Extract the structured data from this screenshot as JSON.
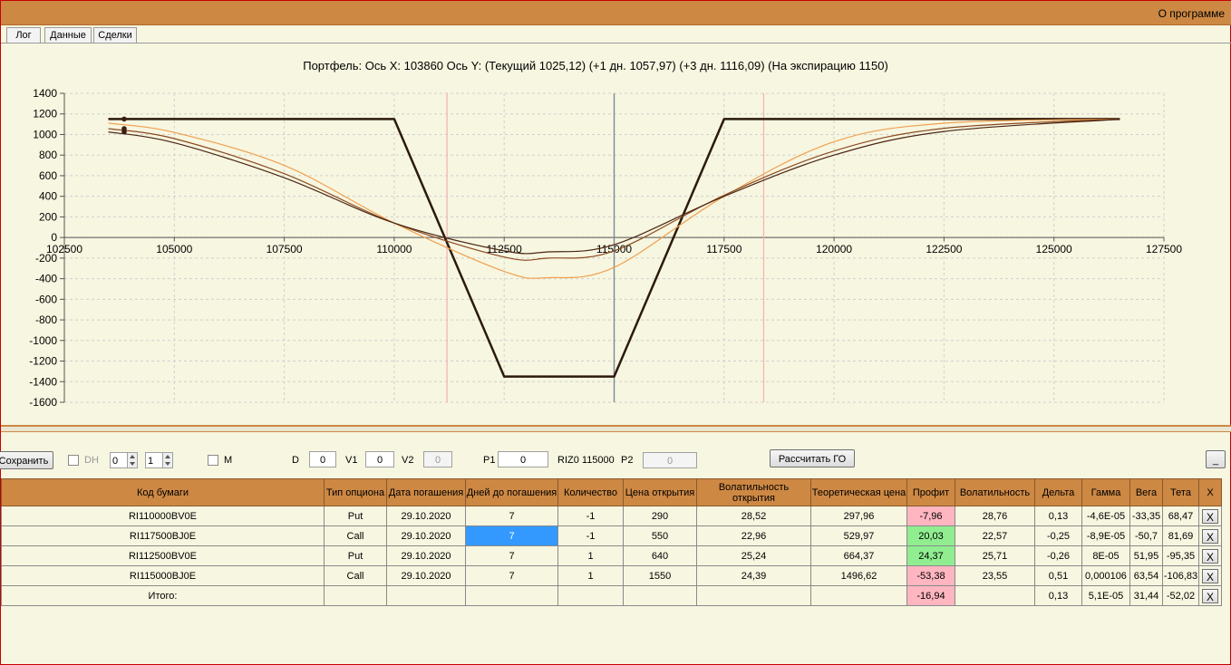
{
  "menu": {
    "about": "О программе"
  },
  "tabs": [
    "Лог",
    "Данные",
    "Сделки"
  ],
  "chart_title": "Портфель: Ось X: 103860 Ось Y:  (Текущий 1025,12)  (+1 дн. 1057,97)  (+3 дн. 1116,09)  (На экспирацию 1150)",
  "chart_data": {
    "type": "line",
    "xlim": [
      102500,
      127500
    ],
    "ylim": [
      -1600,
      1400
    ],
    "x_ticks": [
      102500,
      105000,
      107500,
      110000,
      112500,
      115000,
      117500,
      120000,
      122500,
      125000,
      127500
    ],
    "x_tick_labels": [
      "102500",
      "105000",
      "107500",
      "110000",
      "112500",
      "115000",
      "117500",
      "120000",
      "122500",
      "125000",
      "127500"
    ],
    "y_ticks": [
      1400,
      1200,
      1000,
      800,
      600,
      400,
      200,
      0,
      -200,
      -400,
      -600,
      -800,
      -1000,
      -1200,
      -1400,
      -1600
    ],
    "y_tick_labels": [
      "1400",
      "1200",
      "1000",
      "800",
      "600",
      "400",
      "200",
      "0",
      "-200",
      "-400",
      "-600",
      "-800",
      "-1000",
      "-1200",
      "-1400",
      "-1600"
    ],
    "grid": true,
    "cursor_x": 115000,
    "marker_x": [
      111200,
      118400
    ],
    "current_x": 103860,
    "series": [
      {
        "key": "expiry",
        "color": "#2b1a0e",
        "width": 2.5,
        "points": [
          [
            103500,
            1150
          ],
          [
            110000,
            1150
          ],
          [
            112500,
            -1350
          ],
          [
            115000,
            -1350
          ],
          [
            117500,
            1150
          ],
          [
            126500,
            1150
          ]
        ]
      },
      {
        "key": "plus3",
        "color": "#f0a050",
        "width": 1.2,
        "points": [
          [
            103500,
            1110
          ],
          [
            105000,
            1020
          ],
          [
            107500,
            700
          ],
          [
            110000,
            140
          ],
          [
            112500,
            -330
          ],
          [
            113500,
            -390
          ],
          [
            115000,
            -290
          ],
          [
            117500,
            400
          ],
          [
            120000,
            930
          ],
          [
            122500,
            1110
          ],
          [
            126500,
            1150
          ]
        ]
      },
      {
        "key": "plus1",
        "color": "#8a4a20",
        "width": 1.2,
        "points": [
          [
            103500,
            1057
          ],
          [
            105000,
            960
          ],
          [
            107500,
            620
          ],
          [
            110000,
            140
          ],
          [
            112500,
            -190
          ],
          [
            113500,
            -200
          ],
          [
            115000,
            -130
          ],
          [
            117500,
            410
          ],
          [
            120000,
            840
          ],
          [
            122500,
            1060
          ],
          [
            126500,
            1150
          ]
        ]
      },
      {
        "key": "current",
        "color": "#4a2614",
        "width": 1.2,
        "points": [
          [
            103500,
            1025
          ],
          [
            105000,
            920
          ],
          [
            107500,
            580
          ],
          [
            110000,
            140
          ],
          [
            112500,
            -130
          ],
          [
            113500,
            -140
          ],
          [
            115000,
            -70
          ],
          [
            117500,
            400
          ],
          [
            120000,
            800
          ],
          [
            122500,
            1030
          ],
          [
            126500,
            1148
          ]
        ]
      }
    ],
    "current_points": [
      1150,
      1057,
      1025
    ]
  },
  "controls": {
    "save_label": "Сохранить",
    "dh_label": "DH",
    "spin1": "0",
    "spin2": "1",
    "m_label": "M",
    "d_label": "D",
    "d_value": "0",
    "v1_label": "V1",
    "v1_value": "0",
    "v2_label": "V2",
    "v2_value": "0",
    "p1_label": "P1",
    "p1_value": "0",
    "underlying": "RIZ0 115000",
    "p2_label": "P2",
    "p2_value": "0",
    "calc_label": "Рассчитать ГО",
    "minimize_label": "_"
  },
  "table": {
    "headers": [
      "Код бумаги",
      "Тип опциона",
      "Дата погашения",
      "Дней до погашения",
      "Количество",
      "Цена открытия",
      "Волатильность открытия",
      "Теоретическая цена",
      "Профит",
      "Волатильность",
      "Дельта",
      "Гамма",
      "Вега",
      "Тета",
      "X"
    ],
    "rows": [
      {
        "cells": [
          "RI110000BV0E",
          "Put",
          "29.10.2020",
          "7",
          "-1",
          "290",
          "28,52",
          "297,96",
          "-7,96",
          "28,76",
          "0,13",
          "-4,6E-05",
          "-33,35",
          "68,47"
        ],
        "profit": "neg",
        "selected": false
      },
      {
        "cells": [
          "RI117500BJ0E",
          "Call",
          "29.10.2020",
          "7",
          "-1",
          "550",
          "22,96",
          "529,97",
          "20,03",
          "22,57",
          "-0,25",
          "-8,9E-05",
          "-50,7",
          "81,69"
        ],
        "profit": "pos",
        "selected": true
      },
      {
        "cells": [
          "RI112500BV0E",
          "Put",
          "29.10.2020",
          "7",
          "1",
          "640",
          "25,24",
          "664,37",
          "24,37",
          "25,71",
          "-0,26",
          "8E-05",
          "51,95",
          "-95,35"
        ],
        "profit": "pos",
        "selected": false
      },
      {
        "cells": [
          "RI115000BJ0E",
          "Call",
          "29.10.2020",
          "7",
          "1",
          "1550",
          "24,39",
          "1496,62",
          "-53,38",
          "23,55",
          "0,51",
          "0,000106",
          "63,54",
          "-106,83"
        ],
        "profit": "neg",
        "selected": false
      }
    ],
    "total": {
      "label": "Итого:",
      "profit": "-16,94",
      "delta": "0,13",
      "gamma": "5,1E-05",
      "vega": "31,44",
      "theta": "-52,02"
    },
    "delete_label": "X"
  }
}
